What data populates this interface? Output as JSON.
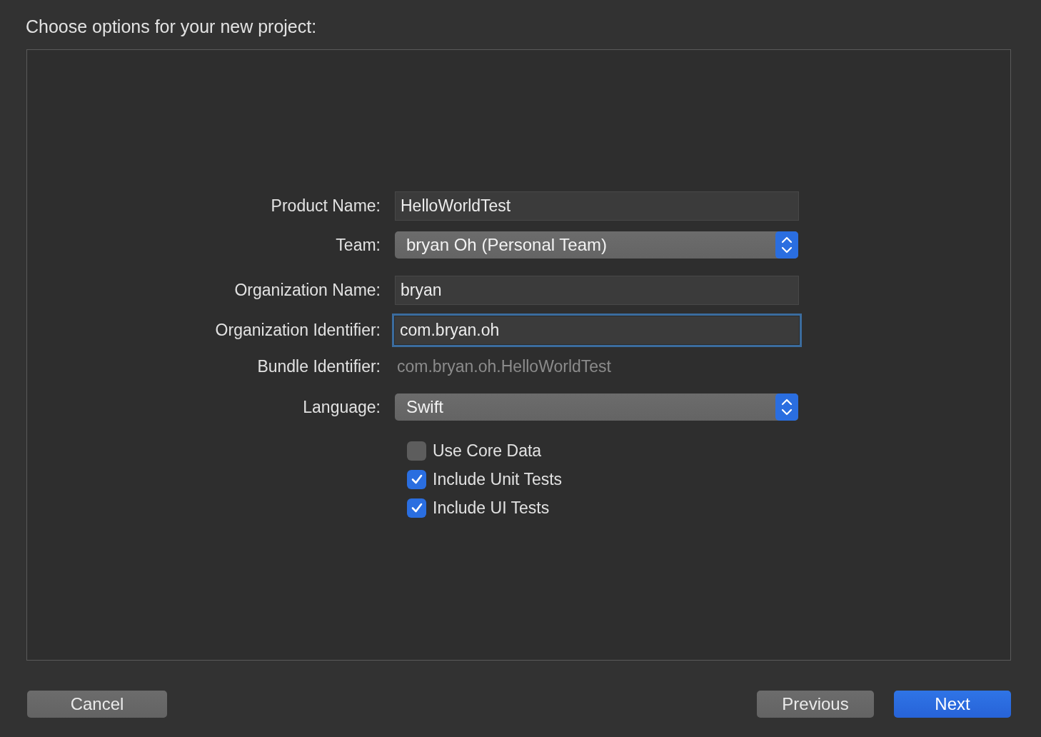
{
  "title": "Choose options for your new project:",
  "form": [
    {
      "kind": "text",
      "label": "Product Name:",
      "value": "HelloWorldTest",
      "focused": false
    },
    {
      "kind": "popup",
      "label": "Team:",
      "value": "bryan Oh (Personal Team)"
    },
    {
      "kind": "text",
      "label": "Organization Name:",
      "value": "bryan",
      "focused": false
    },
    {
      "kind": "text",
      "label": "Organization Identifier:",
      "value": "com.bryan.oh",
      "focused": true
    },
    {
      "kind": "static",
      "label": "Bundle Identifier:",
      "value": "com.bryan.oh.HelloWorldTest"
    },
    {
      "kind": "popup",
      "label": "Language:",
      "value": "Swift"
    }
  ],
  "checkboxes": [
    {
      "label": "Use Core Data",
      "checked": false
    },
    {
      "label": "Include Unit Tests",
      "checked": true
    },
    {
      "label": "Include UI Tests",
      "checked": true
    }
  ],
  "buttons": [
    {
      "label": "Cancel",
      "kind": "normal"
    },
    {
      "label": "Previous",
      "kind": "normal"
    },
    {
      "label": "Next",
      "kind": "default"
    }
  ]
}
